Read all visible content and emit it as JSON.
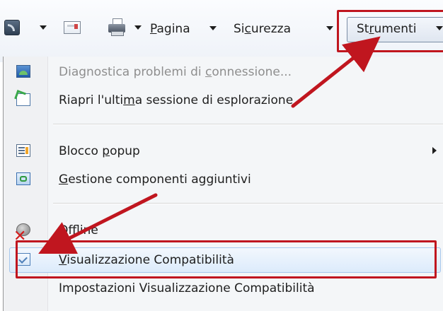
{
  "toolbar": {
    "icons": [
      "rss-icon",
      "mail-icon",
      "print-icon"
    ],
    "pagina": {
      "pre": "",
      "ul": "P",
      "post": "agina"
    },
    "sicurezza": {
      "pre": "Si",
      "ul": "c",
      "post": "urezza"
    },
    "strumenti": {
      "pre": "St",
      "ul": "r",
      "post": "umenti"
    }
  },
  "menu": {
    "items": [
      {
        "pre": "Diagnostica problemi di ",
        "ul": "c",
        "post": "onnessione...",
        "disabled": true,
        "icon": "network-diagnostics-icon"
      },
      {
        "pre": "Riapri l'ulti",
        "ul": "m",
        "post": "a sessione di esplorazione",
        "disabled": false,
        "icon": "reopen-session-icon"
      },
      {
        "pre": "Blocco ",
        "ul": "p",
        "post": "opup",
        "disabled": false,
        "icon": "popup-blocker-icon",
        "submenu": true
      },
      {
        "pre": "",
        "ul": "G",
        "post": "estione componenti aggiuntivi",
        "disabled": false,
        "icon": "addons-icon"
      },
      {
        "pre": "Of",
        "ul": "f",
        "post": "line",
        "disabled": false,
        "icon": "offline-icon"
      },
      {
        "pre": "",
        "ul": "V",
        "post": "isualizzazione Compatibilità",
        "disabled": false,
        "icon": "compatibility-view-icon",
        "highlighted": true
      },
      {
        "pre": "Impostazioni Visualizzazione Compatibilità",
        "ul": "",
        "post": "",
        "disabled": false,
        "icon": ""
      }
    ]
  },
  "colors": {
    "annotation": "#c0161f",
    "highlight": "#dcebfb",
    "disabled_text": "#8e8e8e"
  }
}
